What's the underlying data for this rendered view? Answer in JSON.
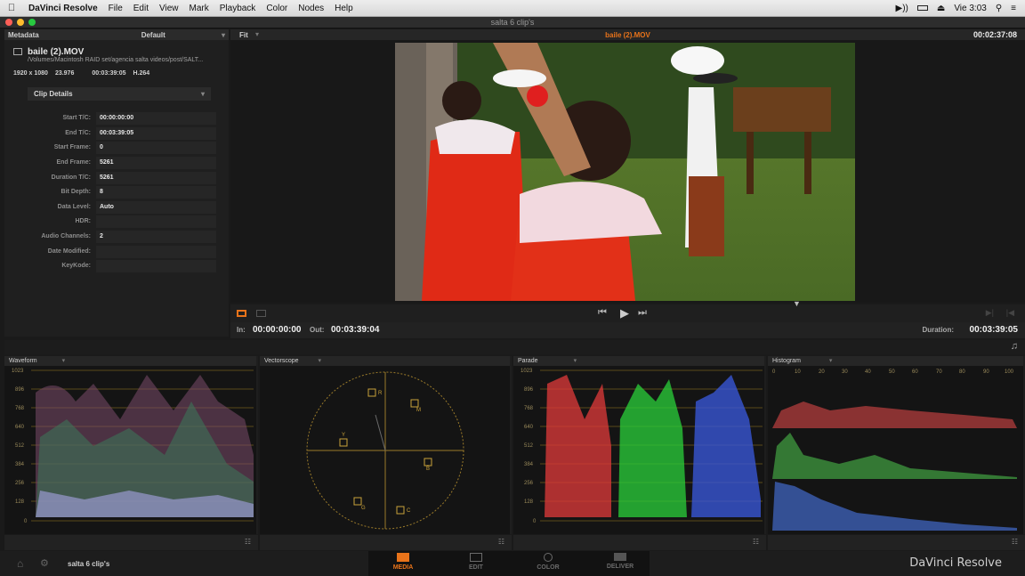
{
  "menubar": {
    "app_name": "DaVinci Resolve",
    "items": [
      "File",
      "Edit",
      "View",
      "Mark",
      "Playback",
      "Color",
      "Nodes",
      "Help"
    ],
    "clock": "Vie 3:03"
  },
  "window": {
    "title": "salta 6 clip's"
  },
  "metadata_panel": {
    "header": "Metadata",
    "preset": "Default",
    "clip_name": "baile (2).MOV",
    "clip_path": "/Volumes/Macintosh RAID set/agencia salta videos/post/SALT...",
    "resolution": "1920 x 1080",
    "fps": "23.976",
    "duration": "00:03:39:05",
    "codec": "H.264",
    "group": "Clip Details",
    "fields": [
      {
        "label": "Start T/C:",
        "value": "00:00:00:00"
      },
      {
        "label": "End T/C:",
        "value": "00:03:39:05"
      },
      {
        "label": "Start Frame:",
        "value": "0"
      },
      {
        "label": "End Frame:",
        "value": "5261"
      },
      {
        "label": "Duration T/C:",
        "value": "5261"
      },
      {
        "label": "Bit Depth:",
        "value": "8"
      },
      {
        "label": "Data Level:",
        "value": "Auto"
      },
      {
        "label": "HDR:",
        "value": ""
      },
      {
        "label": "Audio Channels:",
        "value": "2"
      },
      {
        "label": "Date Modified:",
        "value": ""
      },
      {
        "label": "KeyKode:",
        "value": ""
      }
    ]
  },
  "viewer": {
    "zoom": "Fit",
    "clip_title": "baile (2).MOV",
    "timecode": "00:02:37:08",
    "in_label": "In:",
    "in_value": "00:00:00:00",
    "out_label": "Out:",
    "out_value": "00:03:39:04",
    "duration_label": "Duration:",
    "duration_value": "00:03:39:05"
  },
  "scopes": {
    "waveform": {
      "title": "Waveform",
      "ticks": [
        "1023",
        "896",
        "768",
        "640",
        "512",
        "384",
        "256",
        "128",
        "0"
      ]
    },
    "vectorscope": {
      "title": "Vectorscope",
      "targets": [
        "R",
        "M",
        "Y",
        "B",
        "G",
        "C"
      ]
    },
    "parade": {
      "title": "Parade",
      "ticks": [
        "1023",
        "896",
        "768",
        "640",
        "512",
        "384",
        "256",
        "128",
        "0"
      ]
    },
    "histogram": {
      "title": "Histogram",
      "ticks": [
        "0",
        "10",
        "20",
        "30",
        "40",
        "50",
        "60",
        "70",
        "80",
        "90",
        "100"
      ]
    }
  },
  "bottombar": {
    "project": "salta 6 clip's",
    "pages": [
      "MEDIA",
      "EDIT",
      "COLOR",
      "DELIVER"
    ],
    "active_page": "MEDIA",
    "brand": "DaVinci Resolve"
  },
  "colors": {
    "accent": "#e8731a",
    "active_page": "#e8731a"
  }
}
